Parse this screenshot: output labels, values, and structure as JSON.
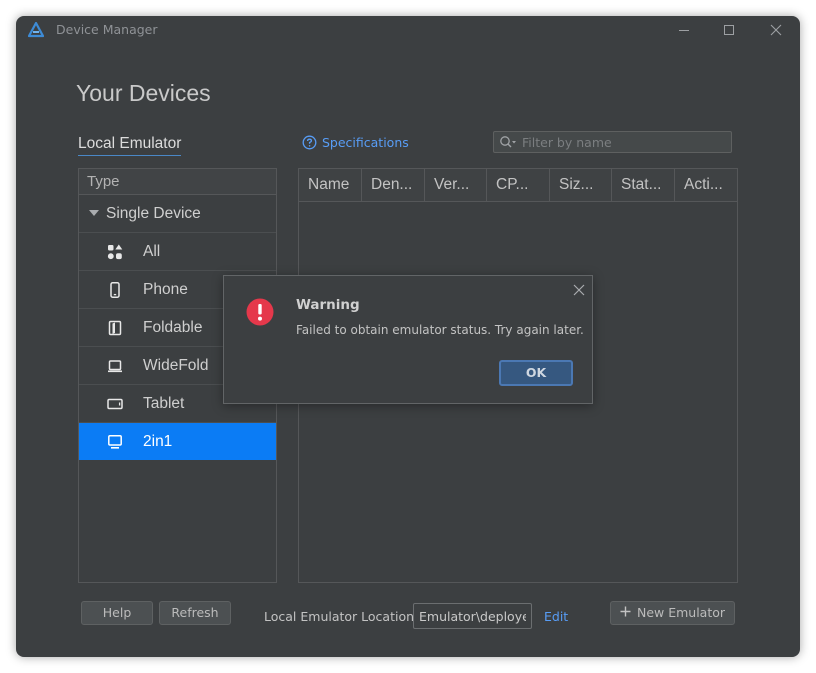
{
  "window": {
    "title": "Device Manager",
    "brand_color": "#3d8bd6"
  },
  "page": {
    "title": "Your Devices"
  },
  "tabs": {
    "local_emulator": "Local Emulator"
  },
  "specifications_link": "Specifications",
  "filter": {
    "placeholder": "Filter by name",
    "value": ""
  },
  "type_panel": {
    "header": "Type",
    "group": "Single Device",
    "items": [
      {
        "label": "All",
        "icon": "apps-icon",
        "selected": false
      },
      {
        "label": "Phone",
        "icon": "phone-icon",
        "selected": false
      },
      {
        "label": "Foldable",
        "icon": "foldable-icon",
        "selected": false
      },
      {
        "label": "WideFold",
        "icon": "widefold-icon",
        "selected": false
      },
      {
        "label": "Tablet",
        "icon": "tablet-icon",
        "selected": false
      },
      {
        "label": "2in1",
        "icon": "laptop-icon",
        "selected": true
      }
    ],
    "selected_color": "#0b7cf5"
  },
  "table": {
    "columns": [
      "Name",
      "Den...",
      "Ver...",
      "CP...",
      "Siz...",
      "Stat...",
      "Acti..."
    ],
    "rows": []
  },
  "footer": {
    "help": "Help",
    "refresh": "Refresh",
    "location_label": "Local Emulator Location:",
    "location_value": "Emulator\\deployed",
    "edit": "Edit",
    "new_emulator": "New Emulator"
  },
  "dialog": {
    "title": "Warning",
    "message": "Failed to obtain emulator status. Try again later.",
    "ok": "OK",
    "icon": "error-icon",
    "icon_color": "#e5384b"
  }
}
